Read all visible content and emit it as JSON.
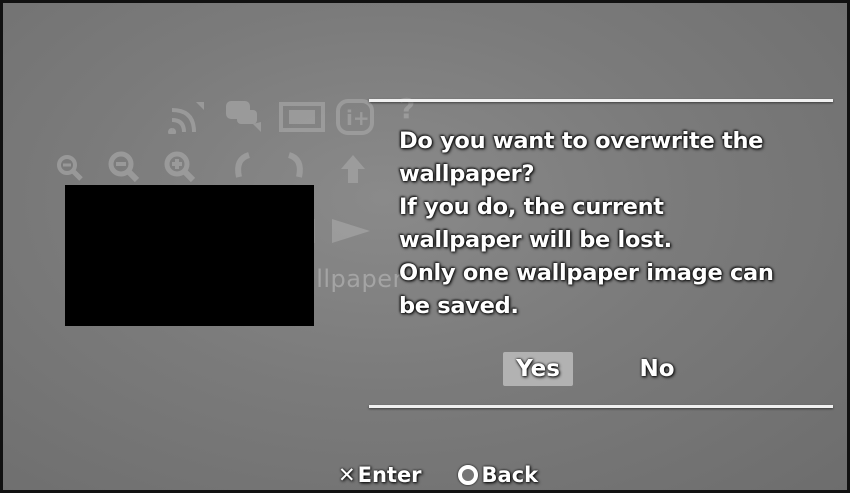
{
  "background": {
    "toolbar_label": "allpaper",
    "icons": [
      "rss-icon",
      "chat-icon",
      "slideshow-icon",
      "info-icon",
      "help-icon",
      "zoom-reset-icon",
      "zoom-out-icon",
      "zoom-in-icon",
      "rotate-left-icon",
      "rotate-right-icon",
      "up-arrow-icon",
      "play-icon"
    ]
  },
  "dialog": {
    "lines": [
      "Do you want to overwrite the",
      "wallpaper?",
      "If you do, the current",
      "wallpaper will be lost.",
      "Only one wallpaper image can",
      "be saved."
    ],
    "yes_label": "Yes",
    "no_label": "No",
    "selected": "Yes"
  },
  "footer": {
    "enter_label": "Enter",
    "back_label": "Back"
  },
  "colors": {
    "background": "#7b7b7b",
    "text": "#ffffff",
    "highlight": "#b2b2b2"
  }
}
